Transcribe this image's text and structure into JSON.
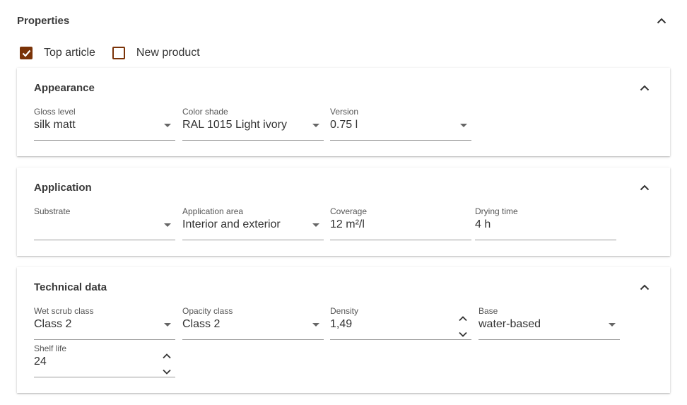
{
  "properties": {
    "title": "Properties",
    "checkboxes": [
      {
        "label": "Top article",
        "checked": true
      },
      {
        "label": "New product",
        "checked": false
      }
    ]
  },
  "appearance": {
    "title": "Appearance",
    "gloss_level": {
      "label": "Gloss level",
      "value": "silk matt"
    },
    "color_shade": {
      "label": "Color shade",
      "value": "RAL 1015 Light ivory"
    },
    "version": {
      "label": "Version",
      "value": "0.75 l"
    }
  },
  "application": {
    "title": "Application",
    "substrate": {
      "label": "Substrate",
      "value": ""
    },
    "application_area": {
      "label": "Application area",
      "value": "Interior and exterior"
    },
    "coverage": {
      "label": "Coverage",
      "value": "12 m²/l"
    },
    "drying_time": {
      "label": "Drying time",
      "value": "4 h"
    }
  },
  "technical": {
    "title": "Technical data",
    "wet_scrub_class": {
      "label": "Wet scrub class",
      "value": "Class 2"
    },
    "opacity_class": {
      "label": "Opacity class",
      "value": "Class 2"
    },
    "density": {
      "label": "Density",
      "value": "1,49"
    },
    "base": {
      "label": "Base",
      "value": "water-based"
    },
    "shelf_life": {
      "label": "Shelf life",
      "value": "24"
    }
  },
  "colors": {
    "accent": "#7a3308",
    "text": "#333333",
    "underline": "#9a9a9a"
  },
  "icons": {
    "collapse": "chevron-up-icon",
    "dropdown": "caret-down-icon",
    "spinner": "spinner-up-down-icon",
    "check": "check-icon"
  }
}
